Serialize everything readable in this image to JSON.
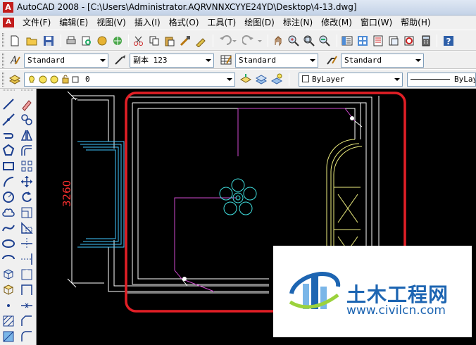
{
  "window": {
    "title": "AutoCAD 2008 - [C:\\Users\\Administrator.AQRVNNXCYYE24YD\\Desktop\\4-13.dwg]",
    "app_icon_glyph": "A"
  },
  "menubar": {
    "items": [
      "文件(F)",
      "编辑(E)",
      "视图(V)",
      "插入(I)",
      "格式(O)",
      "工具(T)",
      "绘图(D)",
      "标注(N)",
      "修改(M)",
      "窗口(W)",
      "帮助(H)"
    ]
  },
  "styles_toolbar": {
    "text_style": "Standard",
    "dim_style": "副本 123",
    "table_style": "Standard",
    "multileader_style": "Standard"
  },
  "layers_toolbar": {
    "layer": "0",
    "color": "ByLayer",
    "linetype": "ByLay"
  },
  "drawing": {
    "dimension_text": "3260",
    "colors": {
      "wall": "#ffffff",
      "window": "#40c8ff",
      "wire": "#d04ad0",
      "fixture": "#40e0e0",
      "door": "#f0f080",
      "dimension": "#ff3030",
      "highlight": "#e21f26"
    }
  },
  "watermark": {
    "brand": "土木工程网",
    "url": "www.civilcn.com",
    "logo_colors": [
      "#1d65b2",
      "#7ab6e8",
      "#9bd23c"
    ]
  }
}
